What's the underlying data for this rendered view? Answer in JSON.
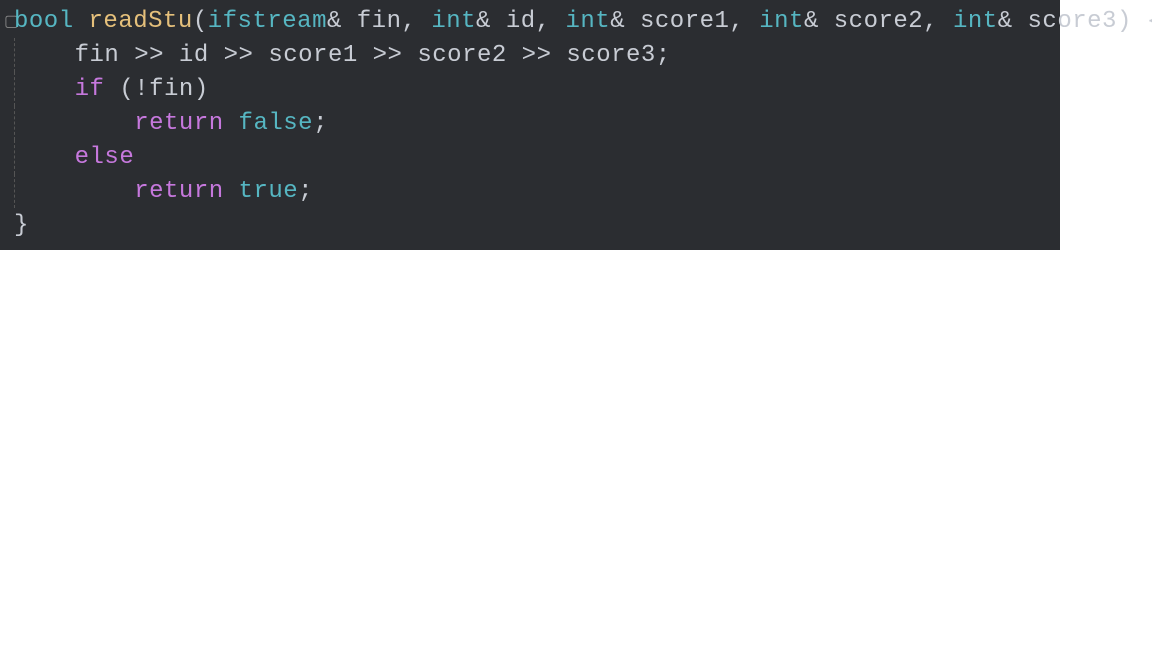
{
  "code": {
    "line1": {
      "kw_bool": "bool",
      "sp1": " ",
      "func": "readStu",
      "paren_o": "(",
      "kw_ifs": "ifstream",
      "amp1": "&",
      "sp2": " ",
      "p_fin": "fin",
      "c1": ", ",
      "kw_int1": "int",
      "amp2": "&",
      "sp3": " ",
      "p_id": "id",
      "c2": ", ",
      "kw_int2": "int",
      "amp3": "&",
      "sp4": " ",
      "p_s1": "score1",
      "c3": ", ",
      "kw_int3": "int",
      "amp4": "&",
      "sp5": " ",
      "p_s2": "score2",
      "c4": ", ",
      "kw_int4": "int",
      "amp5": "&",
      "sp6": " ",
      "p_s3": "score3",
      "paren_c": ")",
      "sp7": " ",
      "brace_o": "{"
    },
    "line2": {
      "text": "    fin >> id >> score1 >> score2 >> score3;"
    },
    "line3": {
      "indent": "    ",
      "kw_if": "if",
      "rest": " (!fin)"
    },
    "line4": {
      "indent": "        ",
      "kw_return": "return",
      "sp": " ",
      "lit": "false",
      "semi": ";"
    },
    "line5": {
      "indent": "    ",
      "kw_else": "else"
    },
    "line6": {
      "indent": "        ",
      "kw_return": "return",
      "sp": " ",
      "lit": "true",
      "semi": ";"
    },
    "line7": {
      "brace_c": "}"
    }
  }
}
